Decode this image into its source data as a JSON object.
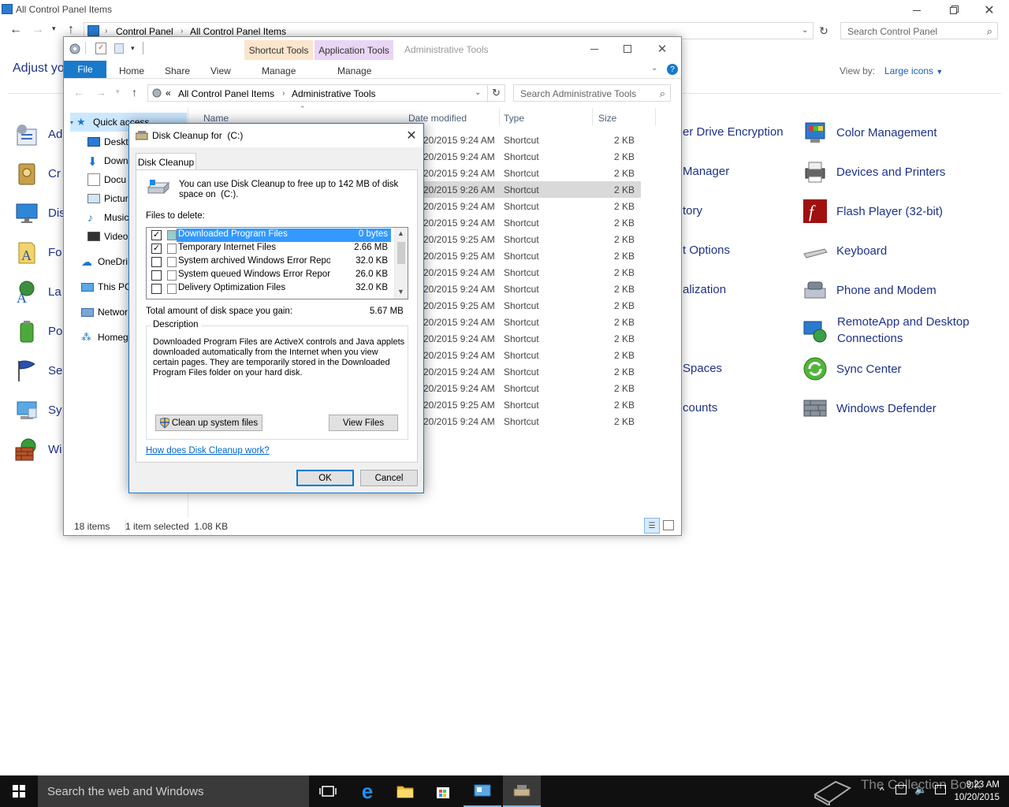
{
  "control_panel": {
    "title": "All Control Panel Items",
    "breadcrumb": [
      "Control Panel",
      "All Control Panel Items"
    ],
    "search_placeholder": "Search Control Panel",
    "heading": "Adjust yo",
    "view_by_label": "View by:",
    "view_by_value": "Large icons",
    "left_column": [
      {
        "label": "Ad",
        "icon": "administrative-tools-icon"
      },
      {
        "label": "Cr",
        "icon": "credential-manager-icon"
      },
      {
        "label": "Dis",
        "icon": "display-icon"
      },
      {
        "label": "Fo",
        "icon": "fonts-icon"
      },
      {
        "label": "La",
        "icon": "language-icon"
      },
      {
        "label": "Po",
        "icon": "power-options-icon"
      },
      {
        "label": "Se",
        "icon": "security-maintenance-icon"
      },
      {
        "label": "Sy",
        "icon": "system-icon"
      },
      {
        "label": "Wi",
        "icon": "windows-firewall-icon"
      }
    ],
    "middle_column": [
      "er Drive Encryption",
      "Manager",
      "tory",
      "t Options",
      "alization",
      "",
      "Spaces",
      "counts"
    ],
    "right_column": [
      {
        "label": "Color Management",
        "icon": "color-management-icon"
      },
      {
        "label": "Devices and Printers",
        "icon": "devices-printers-icon"
      },
      {
        "label": "Flash Player (32-bit)",
        "icon": "flash-player-icon"
      },
      {
        "label": "Keyboard",
        "icon": "keyboard-icon"
      },
      {
        "label": "Phone and Modem",
        "icon": "phone-modem-icon"
      },
      {
        "label": "RemoteApp and Desktop Connections",
        "icon": "remoteapp-icon"
      },
      {
        "label": "Sync Center",
        "icon": "sync-center-icon"
      },
      {
        "label": "Windows Defender",
        "icon": "windows-defender-icon"
      }
    ]
  },
  "admin_tools": {
    "title": "Administrative Tools",
    "context_tabs": [
      {
        "group": "Shortcut Tools",
        "tab": "Manage",
        "color": "#fce4c8"
      },
      {
        "group": "Application Tools",
        "tab": "Manage",
        "color": "#e8d4f4"
      }
    ],
    "ribbon_tabs": [
      "File",
      "Home",
      "Share",
      "View"
    ],
    "breadcrumb_prefix": "«",
    "breadcrumb": [
      "All Control Panel Items",
      "Administrative Tools"
    ],
    "search_placeholder": "Search Administrative Tools",
    "columns": [
      "Name",
      "Date modified",
      "Type",
      "Size"
    ],
    "nav_tree": [
      {
        "label": "Quick access",
        "icon": "star-icon"
      },
      {
        "label": "Deskt",
        "icon": "desktop-icon"
      },
      {
        "label": "Down",
        "icon": "downloads-icon"
      },
      {
        "label": "Docu",
        "icon": "documents-icon"
      },
      {
        "label": "Pictur",
        "icon": "pictures-icon"
      },
      {
        "label": "Music",
        "icon": "music-icon"
      },
      {
        "label": "Video",
        "icon": "videos-icon"
      },
      {
        "label": "OneDri",
        "icon": "onedrive-icon"
      },
      {
        "label": "This PC",
        "icon": "this-pc-icon"
      },
      {
        "label": "Networ",
        "icon": "network-icon"
      },
      {
        "label": "Homeg",
        "icon": "homegroup-icon"
      }
    ],
    "rows": [
      {
        "date": "20/2015 9:24 AM",
        "type": "Shortcut",
        "size": "2 KB"
      },
      {
        "date": "20/2015 9:24 AM",
        "type": "Shortcut",
        "size": "2 KB"
      },
      {
        "date": "20/2015 9:24 AM",
        "type": "Shortcut",
        "size": "2 KB"
      },
      {
        "date": "20/2015 9:26 AM",
        "type": "Shortcut",
        "size": "2 KB"
      },
      {
        "date": "20/2015 9:24 AM",
        "type": "Shortcut",
        "size": "2 KB"
      },
      {
        "date": "20/2015 9:24 AM",
        "type": "Shortcut",
        "size": "2 KB"
      },
      {
        "date": "20/2015 9:25 AM",
        "type": "Shortcut",
        "size": "2 KB"
      },
      {
        "date": "20/2015 9:25 AM",
        "type": "Shortcut",
        "size": "2 KB"
      },
      {
        "date": "20/2015 9:24 AM",
        "type": "Shortcut",
        "size": "2 KB"
      },
      {
        "date": "20/2015 9:24 AM",
        "type": "Shortcut",
        "size": "2 KB"
      },
      {
        "date": "20/2015 9:25 AM",
        "type": "Shortcut",
        "size": "2 KB"
      },
      {
        "date": "20/2015 9:24 AM",
        "type": "Shortcut",
        "size": "2 KB"
      },
      {
        "date": "20/2015 9:24 AM",
        "type": "Shortcut",
        "size": "2 KB"
      },
      {
        "date": "20/2015 9:24 AM",
        "type": "Shortcut",
        "size": "2 KB"
      },
      {
        "date": "20/2015 9:24 AM",
        "type": "Shortcut",
        "size": "2 KB"
      },
      {
        "date": "20/2015 9:24 AM",
        "type": "Shortcut",
        "size": "2 KB"
      },
      {
        "date": "20/2015 9:25 AM",
        "type": "Shortcut",
        "size": "2 KB"
      },
      {
        "date": "20/2015 9:24 AM",
        "type": "Shortcut",
        "size": "2 KB"
      }
    ],
    "selected_row_index": 3,
    "status_items": "18 items",
    "status_selected": "1 item selected  1.08 KB"
  },
  "disk_cleanup": {
    "title": "Disk Cleanup for  (C:)",
    "tab": "Disk Cleanup",
    "intro": "You can use Disk Cleanup to free up to 142 MB of disk space on  (C:).",
    "files_label": "Files to delete:",
    "files": [
      {
        "name": "Downloaded Program Files",
        "size": "0 bytes",
        "checked": true,
        "selected": true
      },
      {
        "name": "Temporary Internet Files",
        "size": "2.66 MB",
        "checked": true,
        "selected": false
      },
      {
        "name": "System archived Windows Error Repor...",
        "size": "32.0 KB",
        "checked": false,
        "selected": false
      },
      {
        "name": "System queued Windows Error Reporti...",
        "size": "26.0 KB",
        "checked": false,
        "selected": false
      },
      {
        "name": "Delivery Optimization Files",
        "size": "32.0 KB",
        "checked": false,
        "selected": false
      }
    ],
    "total_label": "Total amount of disk space you gain:",
    "total_value": "5.67 MB",
    "description_legend": "Description",
    "description_text": "Downloaded Program Files are ActiveX controls and Java applets downloaded automatically from the Internet when you view certain pages. They are temporarily stored in the Downloaded Program Files folder on your hard disk.",
    "cleanup_system_button": "Clean up system files",
    "view_files_button": "View Files",
    "help_link": "How does Disk Cleanup work?",
    "ok_button": "OK",
    "cancel_button": "Cancel"
  },
  "taskbar": {
    "search_placeholder": "Search the web and Windows",
    "time": "9:23 AM",
    "date": "10/20/2015",
    "watermark": "The Collection Book"
  }
}
